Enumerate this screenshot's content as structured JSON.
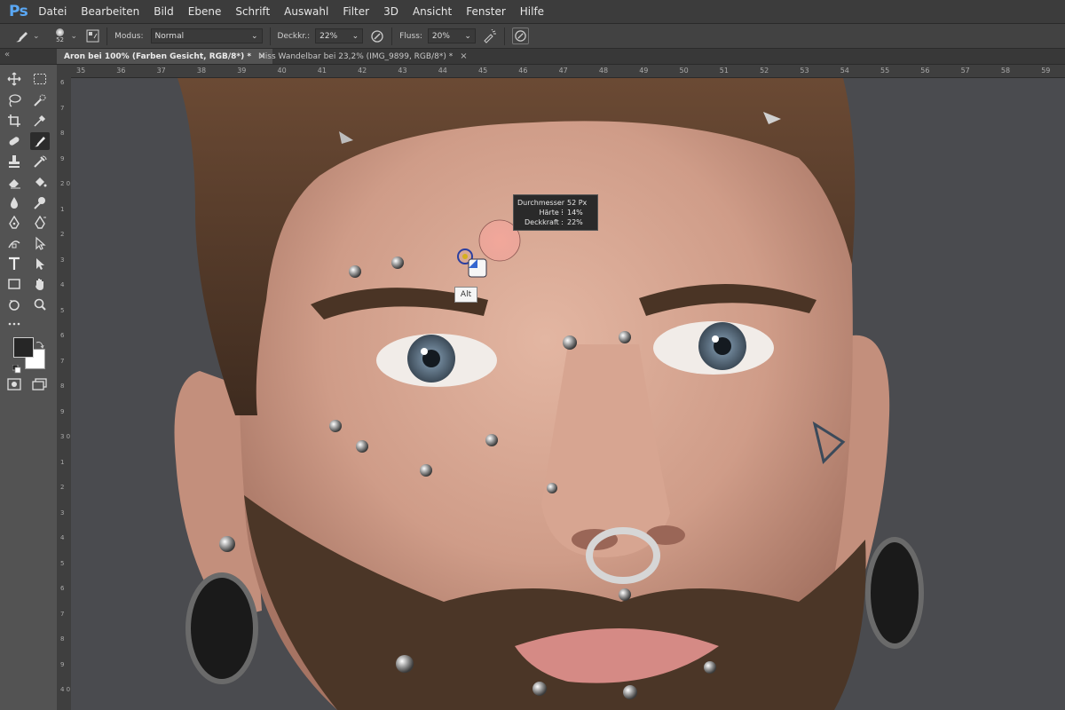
{
  "app": {
    "logo": "Ps"
  },
  "menu": [
    "Datei",
    "Bearbeiten",
    "Bild",
    "Ebene",
    "Schrift",
    "Auswahl",
    "Filter",
    "3D",
    "Ansicht",
    "Fenster",
    "Hilfe"
  ],
  "options": {
    "brush_size": "52",
    "modus_label": "Modus:",
    "modus_value": "Normal",
    "deckkraft_label": "Deckkr.:",
    "deckkraft_value": "22%",
    "fluss_label": "Fluss:",
    "fluss_value": "20%"
  },
  "tabs": [
    {
      "label": "Aron bei 100% (Farben Gesicht, RGB/8*) *",
      "close": "×"
    },
    {
      "label": "Miss Wandelbar bei 23,2% (IMG_9899, RGB/8*) *",
      "close": "×"
    }
  ],
  "collapse_glyph": "«",
  "ruler": {
    "h": [
      "35",
      "36",
      "37",
      "38",
      "39",
      "40",
      "41",
      "42",
      "43",
      "44",
      "45",
      "46",
      "47",
      "48",
      "49",
      "50",
      "51",
      "52",
      "53",
      "54",
      "55",
      "56",
      "57",
      "58",
      "59"
    ],
    "v": [
      "6",
      "7",
      "8",
      "9",
      "2 0",
      "1",
      "2",
      "3",
      "4",
      "5",
      "6",
      "7",
      "8",
      "9",
      "3 0",
      "1",
      "2",
      "3",
      "4",
      "5",
      "6",
      "7",
      "8",
      "9",
      "4 0"
    ]
  },
  "tooltip": {
    "diameter_label": "Durchmesser :",
    "diameter_value": "52 Px",
    "hardness_label": "Härte :",
    "hardness_value": "14%",
    "opacity_label": "Deckkraft :",
    "opacity_value": "22%"
  },
  "alt_label": "Alt",
  "colors": {
    "foreground": "#262626",
    "background": "#ffffff",
    "brush_cursor": "#f0a59a",
    "canvas_bg": "#4a4b4f"
  },
  "icons": {
    "tools": [
      "move-icon",
      "marquee-icon",
      "lasso-icon",
      "quick-select-icon",
      "crop-icon",
      "eyedropper-icon",
      "healing-icon",
      "brush-icon",
      "stamp-icon",
      "history-brush-icon",
      "eraser-icon",
      "bucket-icon",
      "blur-icon",
      "dodge-icon",
      "pen-icon",
      "freeform-pen-icon",
      "path-icon",
      "direct-select-icon",
      "type-icon",
      "path-select-icon",
      "rectangle-icon",
      "hand-icon",
      "rotate-view-icon",
      "zoom-icon",
      "more-icon",
      "quickmask-icon",
      "screenmode-icon"
    ]
  }
}
